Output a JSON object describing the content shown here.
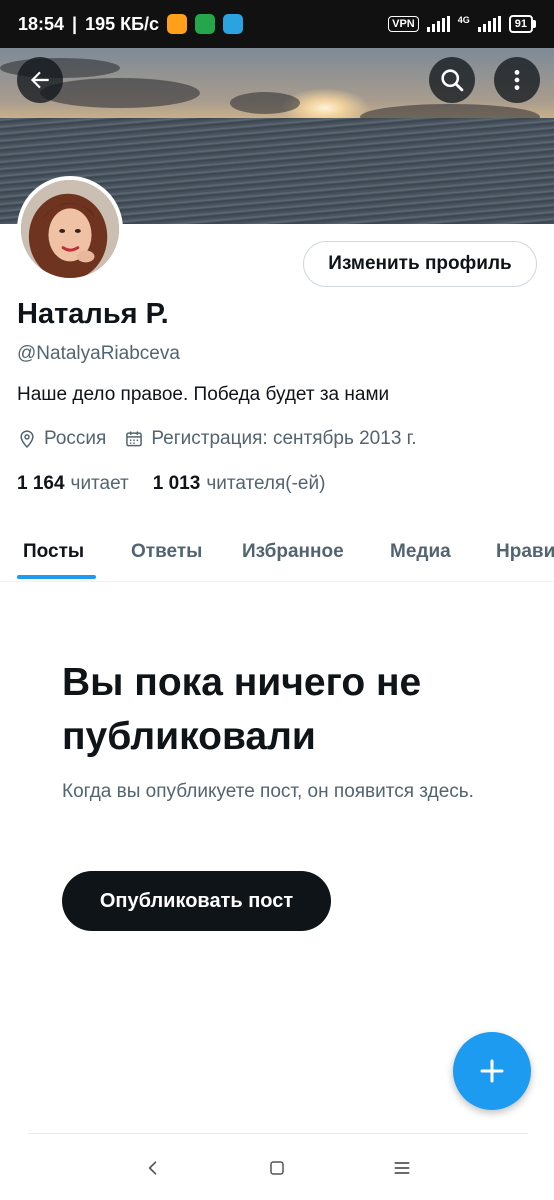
{
  "status_bar": {
    "time": "18:54",
    "speed": "195 КБ/с",
    "vpn": "VPN",
    "network": "4G",
    "battery": "91"
  },
  "profile": {
    "display_name": "Наталья Р.",
    "handle": "@NatalyaRiabceva",
    "bio": "Наше дело правое. Победа будет за нами",
    "location": "Россия",
    "joined": "Регистрация: сентябрь 2013 г.",
    "following_count": "1 164",
    "following_label": "читает",
    "followers_count": "1 013",
    "followers_label": "читателя(-ей)",
    "edit_button": "Изменить профиль"
  },
  "tabs": [
    {
      "label": "Посты",
      "active": true
    },
    {
      "label": "Ответы",
      "active": false
    },
    {
      "label": "Избранное",
      "active": false
    },
    {
      "label": "Медиа",
      "active": false
    },
    {
      "label": "Нрави",
      "active": false
    }
  ],
  "empty_state": {
    "title": "Вы пока ничего не публиковали",
    "subtitle": "Когда вы опубликуете пост, он появится здесь.",
    "button": "Опубликовать пост"
  },
  "icons": {
    "back": "arrow-left-icon",
    "search": "search-icon",
    "more": "more-vertical-icon",
    "location": "location-pin-icon",
    "calendar": "calendar-icon",
    "compose": "plus-icon"
  },
  "colors": {
    "accent": "#1d9bf0",
    "text_primary": "#0f1419",
    "text_secondary": "#536471"
  }
}
